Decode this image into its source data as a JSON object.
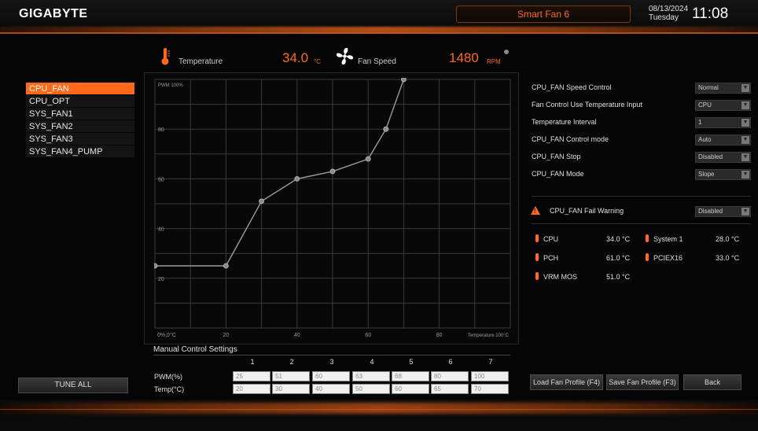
{
  "header": {
    "logo": "GIGABYTE",
    "mode": "Smart Fan 6",
    "date": "08/13/2024",
    "day": "Tuesday",
    "time": "11:08"
  },
  "readouts": {
    "temperature_label": "Temperature",
    "temperature_value": "34.0",
    "temperature_unit": "°C",
    "fan_speed_label": "Fan Speed",
    "fan_speed_value": "1480",
    "fan_speed_unit": "RPM"
  },
  "fan_list": [
    "CPU_FAN",
    "CPU_OPT",
    "SYS_FAN1",
    "SYS_FAN2",
    "SYS_FAN3",
    "SYS_FAN4_PUMP"
  ],
  "tune_all_label": "TUNE ALL",
  "graph": {
    "y_axis_title": "PWM 100%",
    "y_ticks": [
      "80",
      "60",
      "40",
      "20"
    ],
    "x_ticks": [
      "0%,0°C",
      "20",
      "40",
      "60",
      "80",
      "Temperature 100°C"
    ],
    "points": [
      {
        "temp": 0,
        "pwm": 25
      },
      {
        "temp": 20,
        "pwm": 25
      },
      {
        "temp": 30,
        "pwm": 51
      },
      {
        "temp": 40,
        "pwm": 60
      },
      {
        "temp": 50,
        "pwm": 63
      },
      {
        "temp": 60,
        "pwm": 68
      },
      {
        "temp": 65,
        "pwm": 80
      },
      {
        "temp": 70,
        "pwm": 100
      }
    ]
  },
  "manual": {
    "title": "Manual Control Settings",
    "columns": [
      "1",
      "2",
      "3",
      "4",
      "5",
      "6",
      "7"
    ],
    "pwm_label": "PWM(%)",
    "temp_label": "Temp(°C)",
    "pwm_values": [
      "25",
      "51",
      "60",
      "63",
      "68",
      "80",
      "100"
    ],
    "temp_values": [
      "20",
      "30",
      "40",
      "50",
      "60",
      "65",
      "70"
    ]
  },
  "settings": [
    {
      "label": "CPU_FAN Speed Control",
      "value": "Normal"
    },
    {
      "label": "Fan Control Use Temperature Input",
      "value": "CPU"
    },
    {
      "label": "Temperature Interval",
      "value": "1"
    },
    {
      "label": "CPU_FAN Control mode",
      "value": "Auto"
    },
    {
      "label": "CPU_FAN Stop",
      "value": "Disabled"
    },
    {
      "label": "CPU_FAN Mode",
      "value": "Slope"
    }
  ],
  "fail_warning": {
    "label": "CPU_FAN Fail Warning",
    "value": "Disabled"
  },
  "temps": [
    {
      "name": "CPU",
      "value": "34.0 °C"
    },
    {
      "name": "System 1",
      "value": "28.0 °C"
    },
    {
      "name": "PCH",
      "value": "61.0 °C"
    },
    {
      "name": "PCIEX16",
      "value": "33.0 °C"
    },
    {
      "name": "VRM MOS",
      "value": "51.0 °C"
    }
  ],
  "buttons": {
    "load": "Load Fan Profile (F4)",
    "save": "Save Fan Profile (F3)",
    "back": "Back"
  },
  "colors": {
    "accent": "#ff6a1a"
  }
}
